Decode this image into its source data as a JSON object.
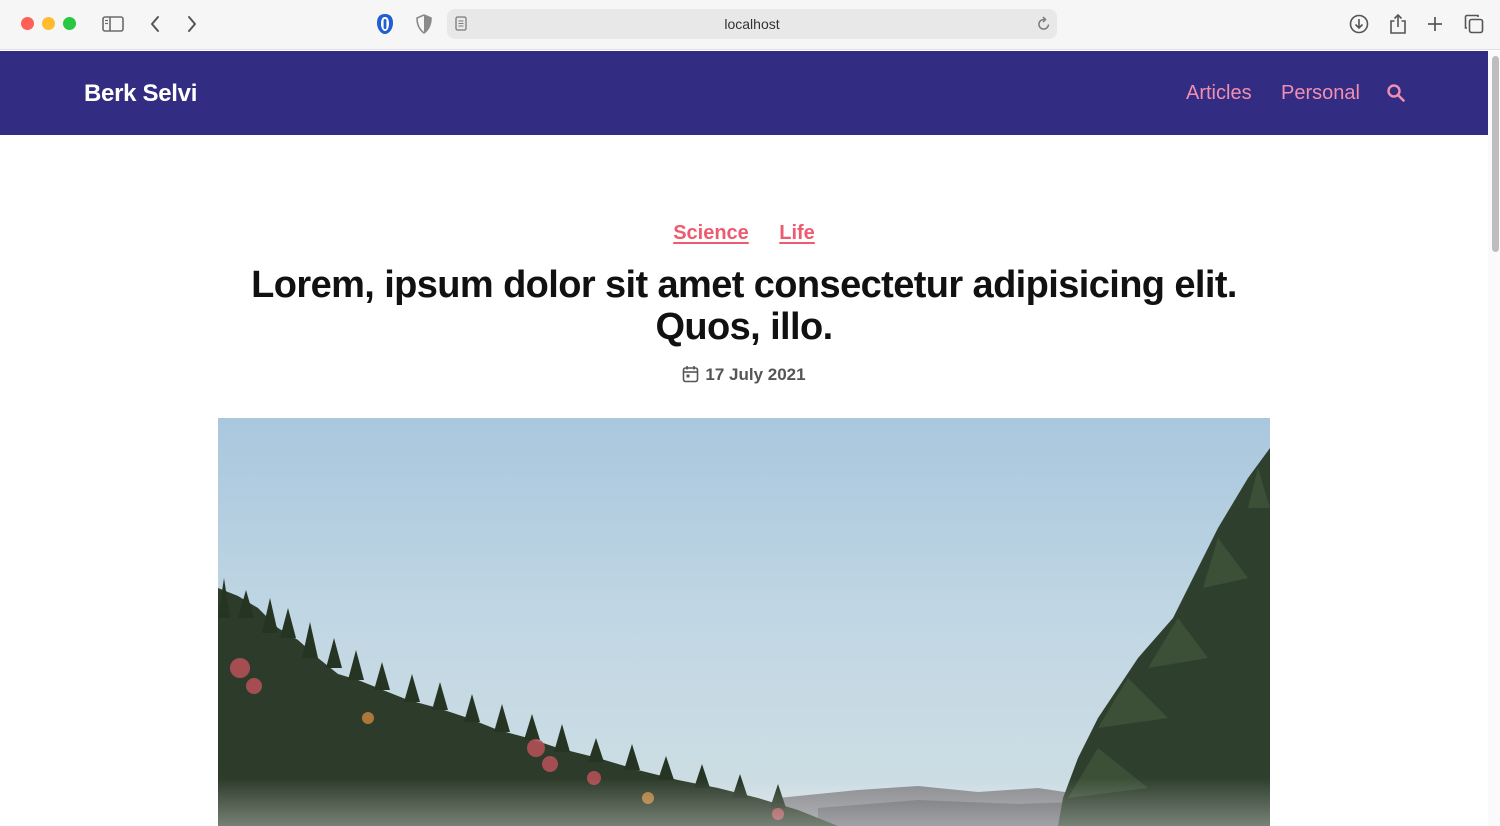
{
  "browser": {
    "url": "localhost",
    "icons": [
      "close-icon",
      "minimize-icon",
      "zoom-icon",
      "sidebar-icon",
      "back-icon",
      "forward-icon",
      "privacy-icon",
      "shield-icon",
      "page-icon",
      "reload-icon",
      "download-icon",
      "share-icon",
      "new-tab-icon",
      "tabs-overview-icon"
    ]
  },
  "site": {
    "title": "Berk Selvi",
    "nav": {
      "articles": "Articles",
      "personal": "Personal"
    },
    "colors": {
      "header_bg": "#322c82",
      "nav_link": "#f08fb0",
      "tag": "#ee5a6f"
    }
  },
  "article": {
    "tags": [
      "Science",
      "Life"
    ],
    "title": "Lorem, ipsum dolor sit amet consectetur adipisicing elit. Quos, illo.",
    "date": "17 July 2021"
  }
}
